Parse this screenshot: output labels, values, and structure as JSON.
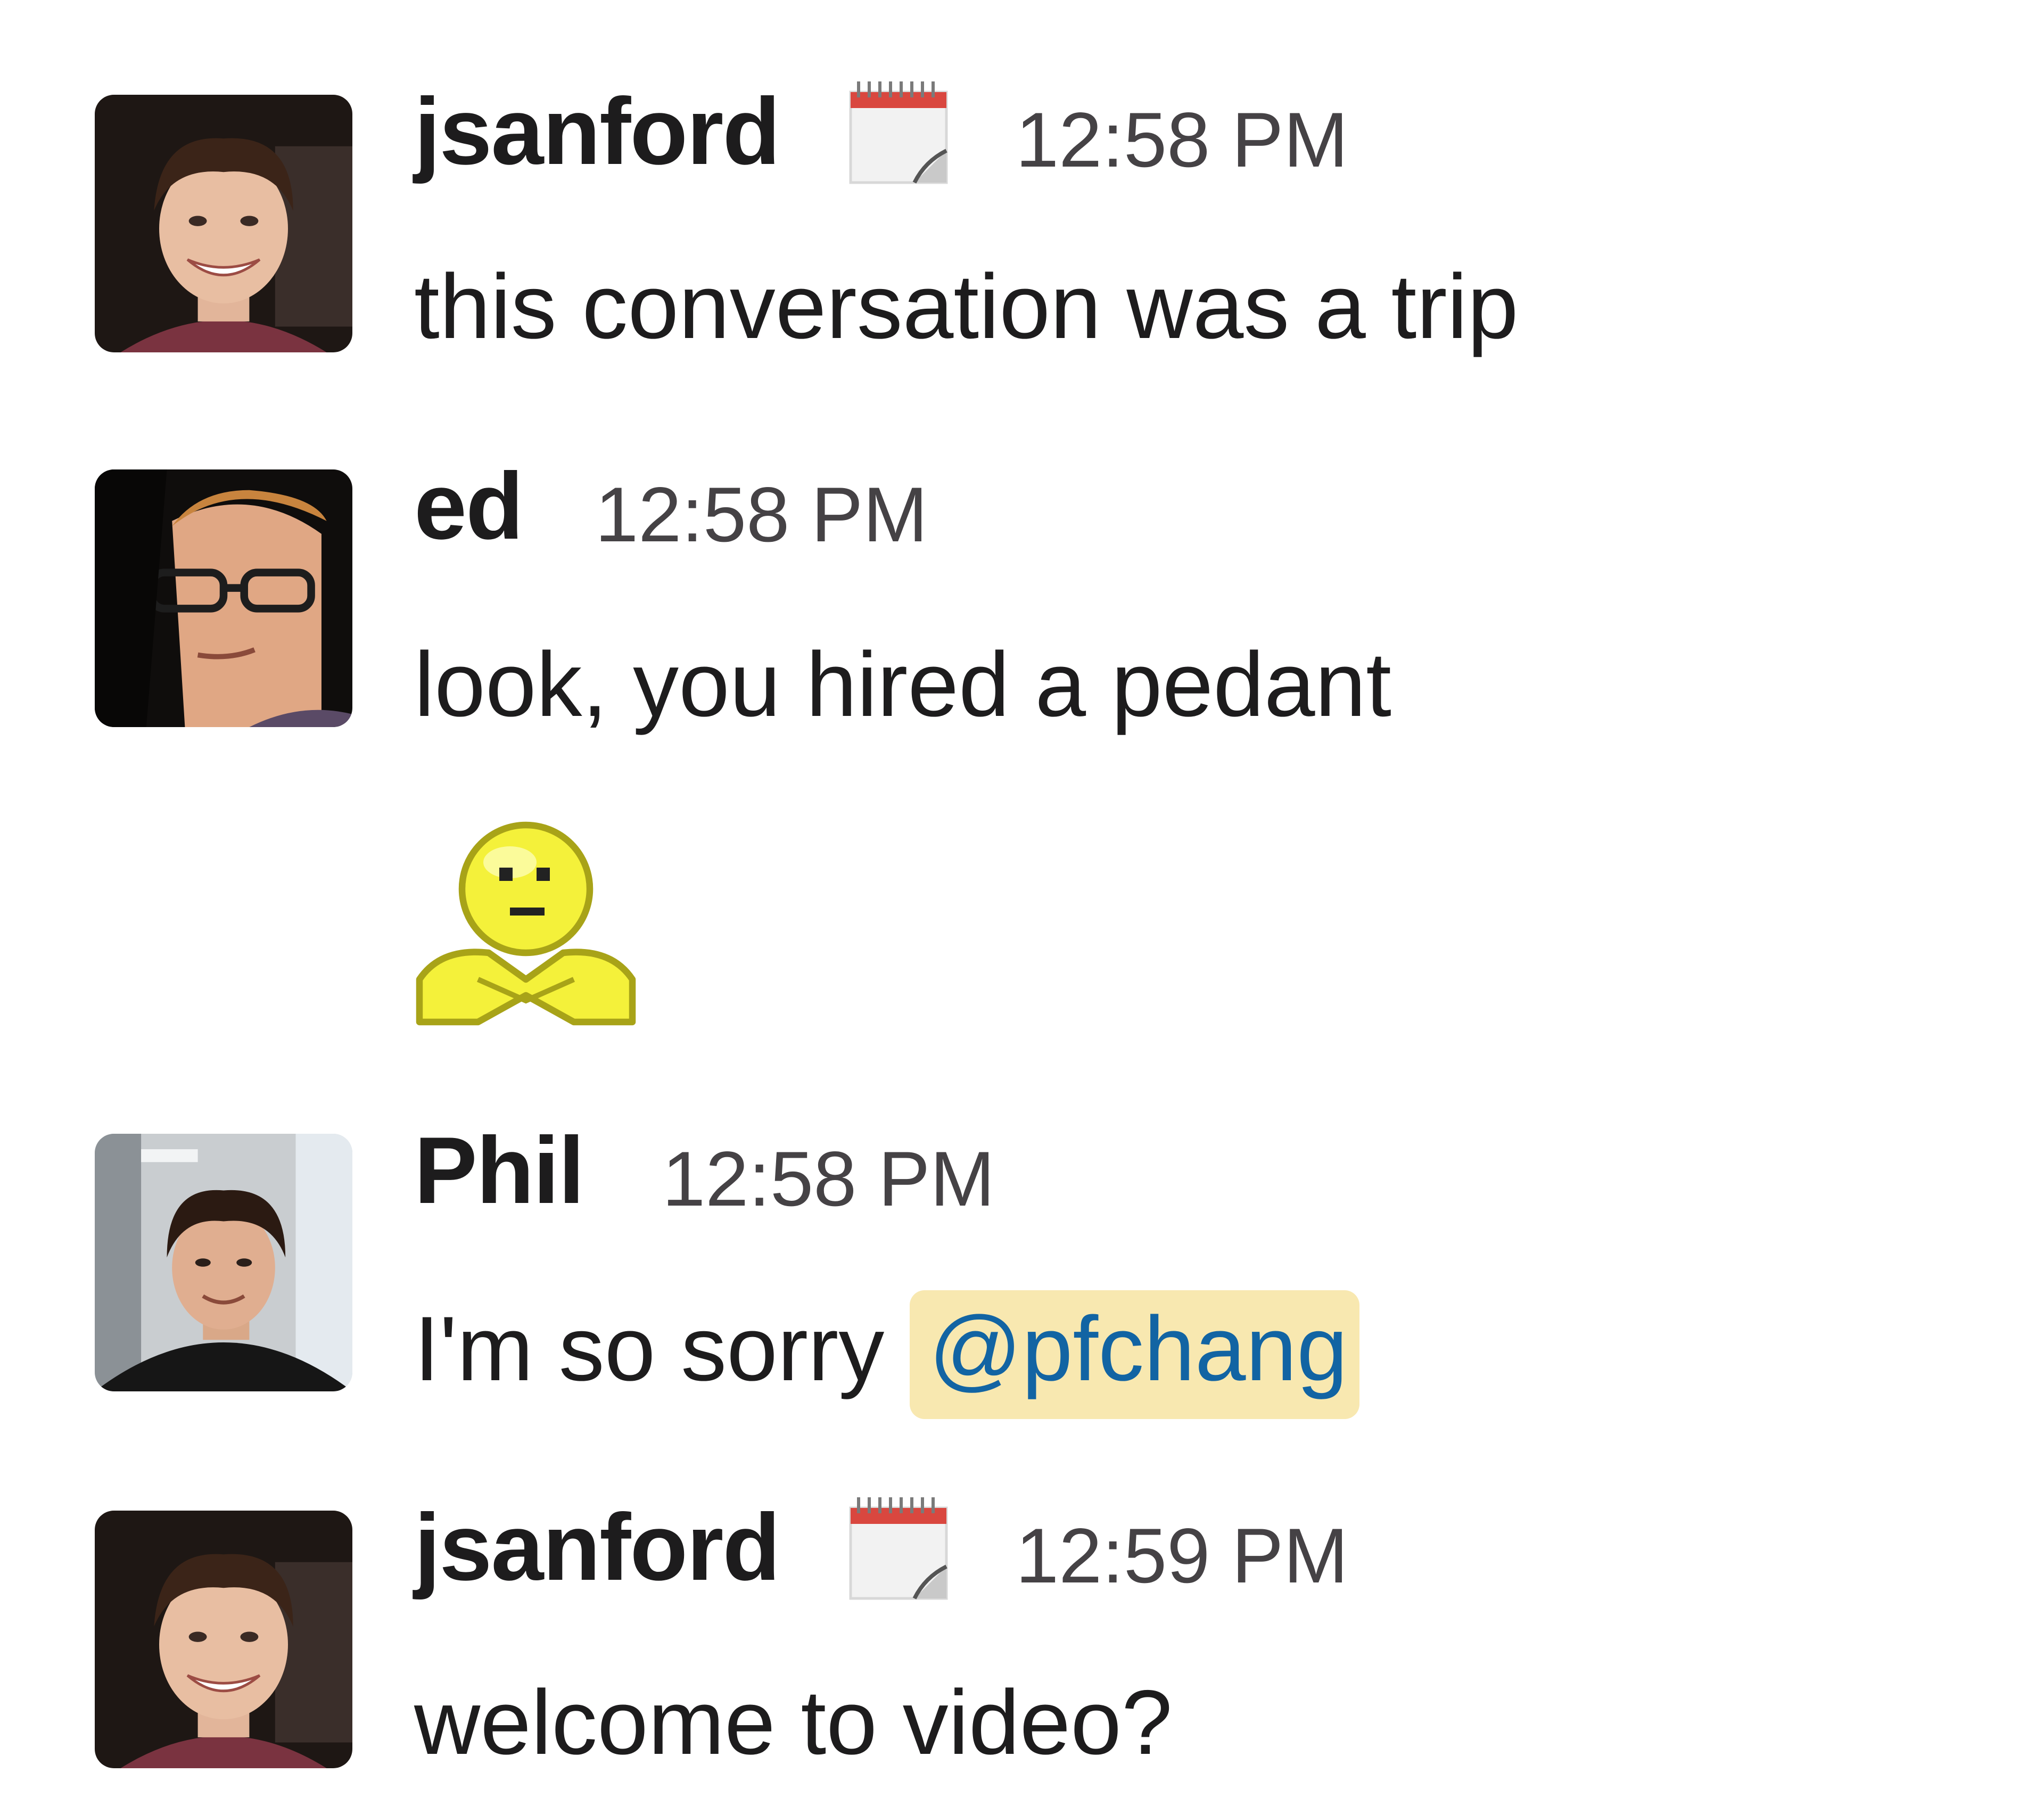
{
  "messages": [
    {
      "username": "jsanford",
      "has_status_icon": true,
      "status_icon": "spiral-calendar-icon",
      "timestamp": "12:58 PM",
      "text": "this conversation was a trip"
    },
    {
      "username": "ed",
      "has_status_icon": false,
      "timestamp": "12:58 PM",
      "text": "look, you hired a pedant",
      "attachment": "arms-crossed-smiley-emoji"
    },
    {
      "username": "Phil",
      "has_status_icon": false,
      "timestamp": "12:58 PM",
      "text_prefix": "I'm so sorry ",
      "mention": "@pfchang"
    },
    {
      "username": "jsanford",
      "has_status_icon": true,
      "status_icon": "spiral-calendar-icon",
      "timestamp": "12:59 PM",
      "text": "welcome to video?"
    }
  ],
  "colors": {
    "text": "#1d1c1d",
    "timestamp": "#454245",
    "mention_bg": "#f8e8b0",
    "mention_text": "#1264a3"
  }
}
